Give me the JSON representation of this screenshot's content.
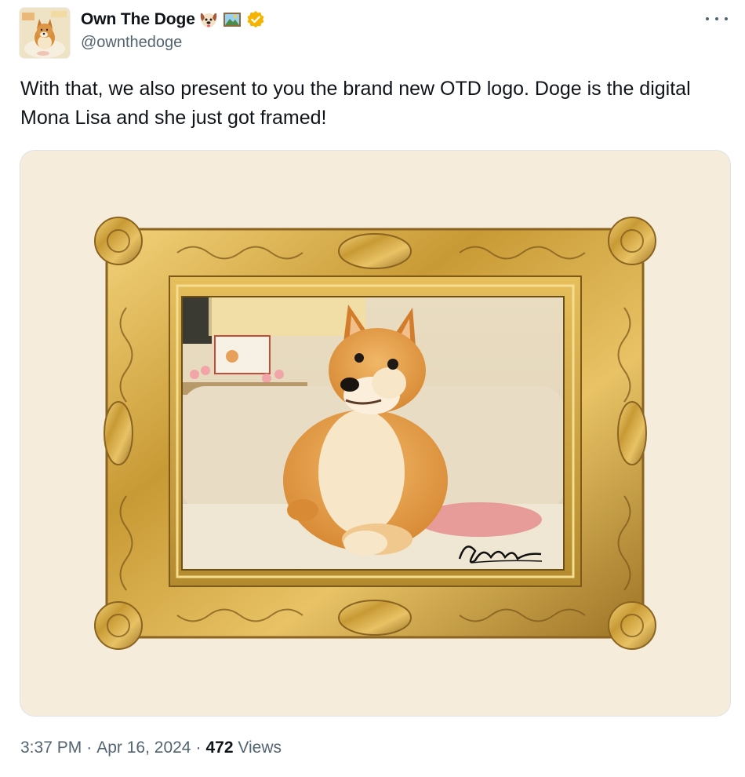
{
  "author": {
    "display_name": "Own The Doge",
    "handle": "@ownthedoge",
    "badges": [
      "dog-face-emoji",
      "framed-picture-emoji",
      "verified-badge-icon"
    ]
  },
  "tweet": {
    "text": "With that, we also present to you the brand new OTD logo. Doge is the digital Mona Lisa and she just got framed!"
  },
  "media": {
    "description": "framed doge painting",
    "signature": "Own The Doge"
  },
  "meta": {
    "time": "3:37 PM",
    "separator1": "·",
    "date": "Apr 16, 2024",
    "separator2": "·",
    "views_count": "472",
    "views_label": "Views"
  },
  "colors": {
    "text": "#0f1419",
    "secondary": "#536471",
    "verified": "#f4b400",
    "media_bg": "#f5ecdb",
    "frame_gold": "#c9a035"
  },
  "icons": [
    "more-options-icon"
  ]
}
